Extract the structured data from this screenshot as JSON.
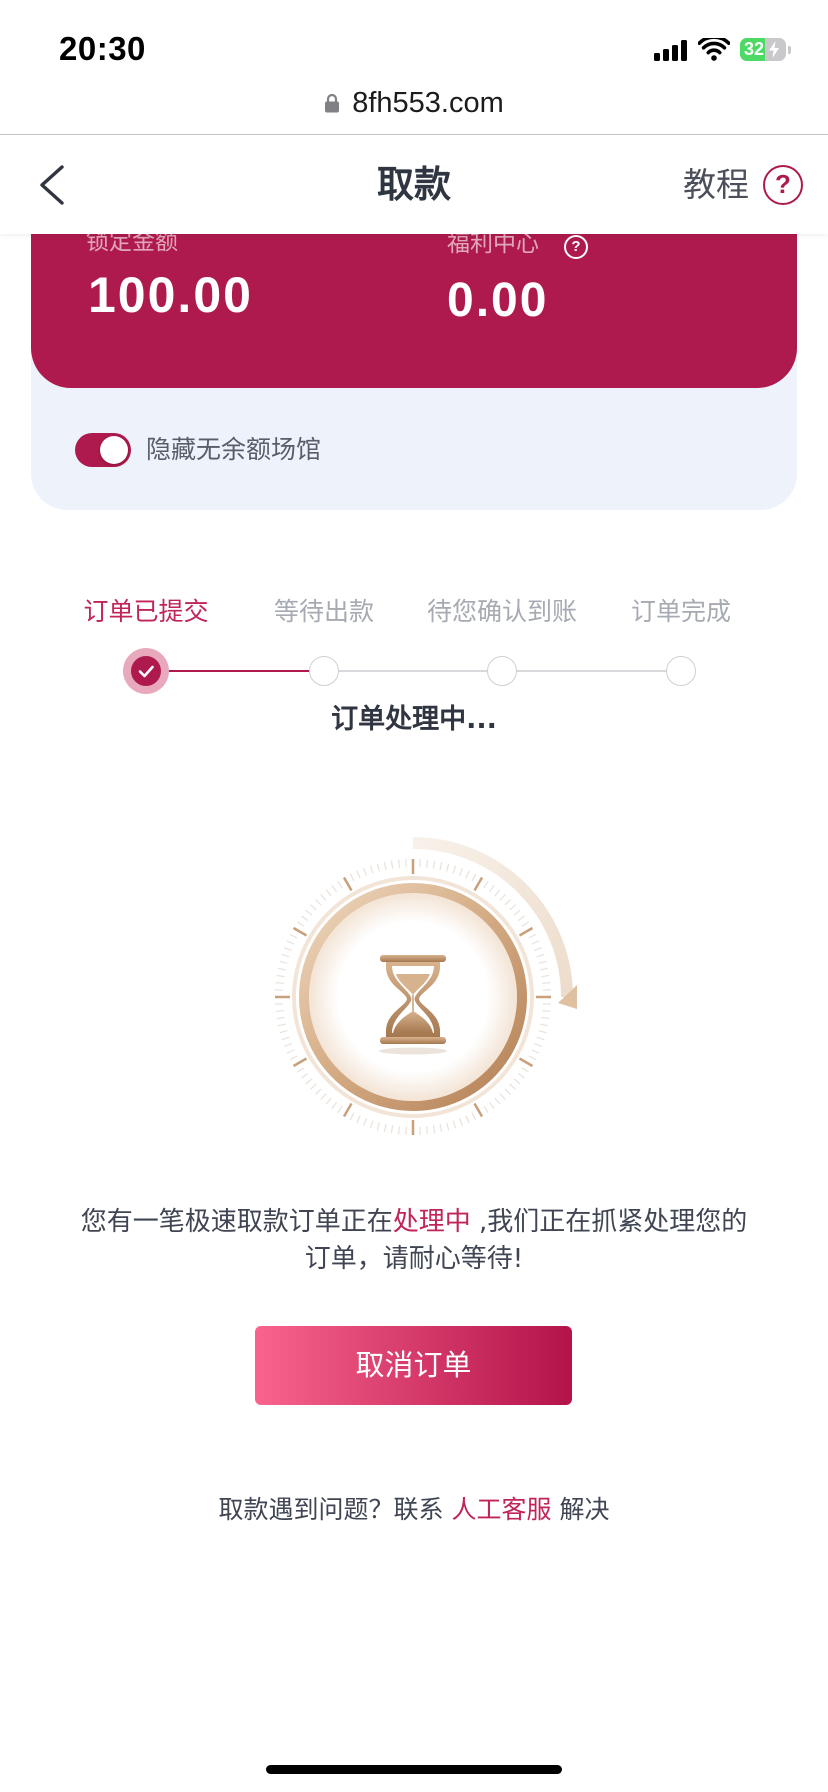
{
  "status_bar": {
    "time": "20:30",
    "battery_level": "32"
  },
  "url_bar": {
    "domain": "8fh553.com"
  },
  "nav": {
    "title": "取款",
    "tutorial_label": "教程",
    "help_symbol": "?"
  },
  "balance_card": {
    "locked_label": "锁定金额",
    "locked_amount": "100.00",
    "welfare_label": "福利中心",
    "welfare_help_symbol": "?",
    "welfare_amount": "0.00"
  },
  "hide_empty_toggle": {
    "label": "隐藏无余额场馆",
    "checked": true
  },
  "progress": {
    "steps": [
      {
        "label": "订单已提交",
        "state": "completed"
      },
      {
        "label": "等待出款",
        "state": "pending"
      },
      {
        "label": "待您确认到账",
        "state": "pending"
      },
      {
        "label": "订单完成",
        "state": "pending"
      }
    ],
    "current_status": "订单处理中..."
  },
  "message": {
    "line1_before": "您有一笔极速取款订单正在",
    "line1_highlight": "处理中",
    "line1_after": " ,我们正在抓紧处理您的",
    "line2": "订单，请耐心等待!"
  },
  "cancel_button": {
    "label": "取消订单"
  },
  "help": {
    "before": "取款遇到问题？联系 ",
    "link": "人工客服",
    "after": " 解决"
  },
  "icons": {
    "back": "chevron-left-icon",
    "tutorial": "question-circle-icon",
    "lock": "lock-icon",
    "status": "hourglass-icon",
    "step_done": "check-icon"
  },
  "theme": {
    "accent": "#ae1a4d",
    "accent_text": "#c0245a",
    "panel_background": "#eef3fb",
    "button_gradient_start": "#f9638c",
    "button_gradient_end": "#b3134a",
    "battery_green": "#4cd964"
  }
}
